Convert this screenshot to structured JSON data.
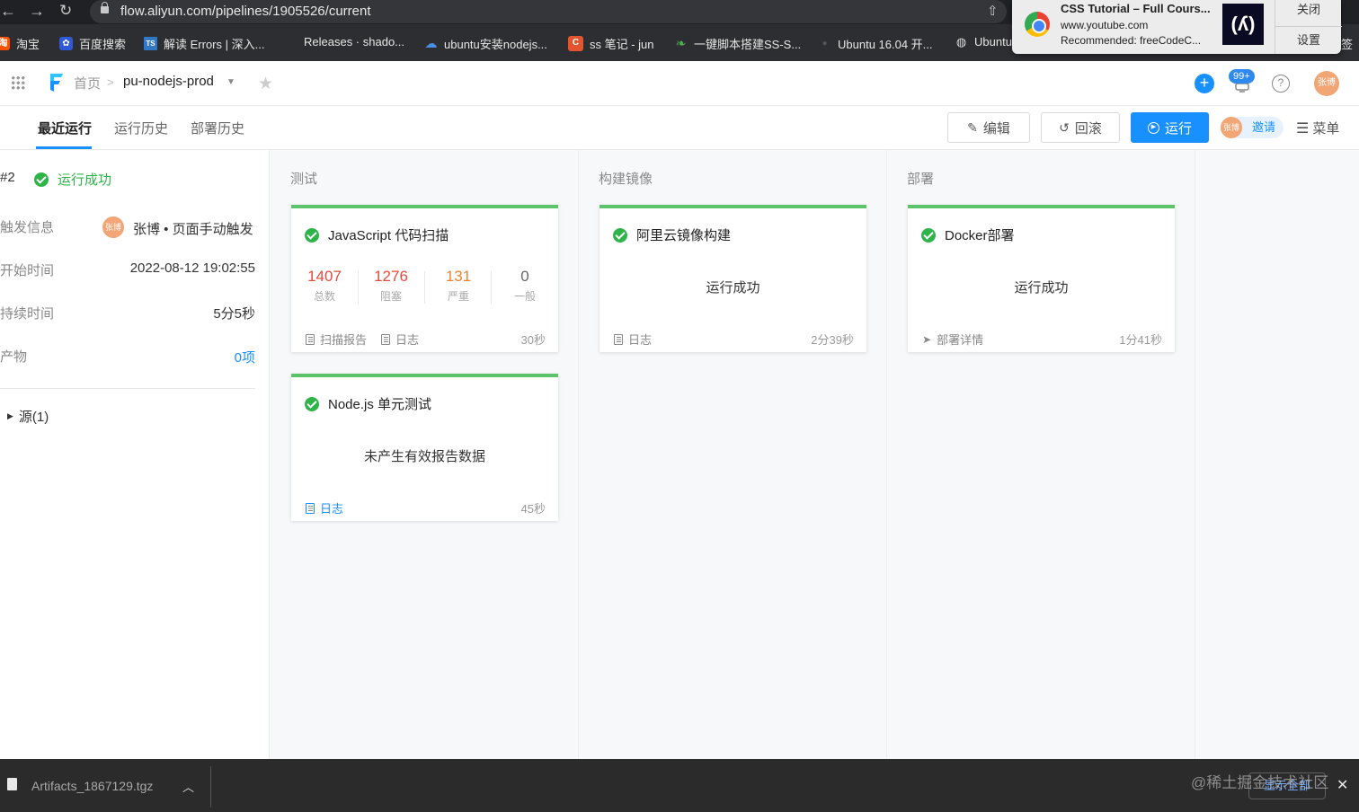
{
  "browser": {
    "url": "flow.aliyun.com/pipelines/1905526/current",
    "bookmarks": [
      {
        "label": "淘宝",
        "icon": "taobao-icon",
        "color": "#ff5000"
      },
      {
        "label": "百度搜索",
        "icon": "baidu-icon",
        "color": "#2f59d8"
      },
      {
        "label": "解读 Errors | 深入...",
        "icon": "ts-icon",
        "color": "#3178c6"
      },
      {
        "label": "Releases · shado...",
        "icon": "github-icon",
        "color": "#2d2e31"
      },
      {
        "label": "ubuntu安装nodejs...",
        "icon": "cloud-icon",
        "color": "#4a8fe7"
      },
      {
        "label": "ss 笔记 - jun",
        "icon": "c-icon",
        "color": "#e4552f"
      },
      {
        "label": "一键脚本搭建SS-S...",
        "icon": "leaf-icon",
        "color": "#4caf50"
      },
      {
        "label": "Ubuntu 16.04 开...",
        "icon": "github-icon",
        "color": "#2d2e31"
      },
      {
        "label": "Ubuntu",
        "icon": "ubuntu-icon",
        "color": "#2d2e31"
      }
    ],
    "trailing_bookmark": "签"
  },
  "notification": {
    "title": "CSS Tutorial – Full Cours...",
    "site": "www.youtube.com",
    "body": "Recommended: freeCodeC...",
    "thumb_text": "(ʎ)",
    "close_label": "关闭",
    "settings_label": "设置"
  },
  "header": {
    "breadcrumb_home": "首页",
    "breadcrumb_separator": ">",
    "pipeline_name": "pu-nodejs-prod",
    "notification_count": "99+",
    "avatar_text": "张博"
  },
  "tabs": [
    {
      "label": "最近运行",
      "active": true
    },
    {
      "label": "运行历史",
      "active": false
    },
    {
      "label": "部署历史",
      "active": false
    }
  ],
  "toolbar": {
    "edit_label": "编辑",
    "rollback_label": "回滚",
    "run_label": "运行",
    "invite_avatar": "张博",
    "invite_label": "邀请",
    "menu_label": "菜单"
  },
  "run_info": {
    "run_number": "#2",
    "status": "运行成功",
    "trigger_label": "触发信息",
    "trigger_avatar": "张博",
    "trigger_value": "张博 • 页面手动触发",
    "start_label": "开始时间",
    "start_value": "2022-08-12 19:02:55",
    "duration_label": "持续时间",
    "duration_value": "5分5秒",
    "artifacts_label": "产物",
    "artifacts_value": "0项",
    "source_label": "源(1)"
  },
  "stages": [
    {
      "name": "测试",
      "jobs": [
        {
          "title": "JavaScript 代码扫描",
          "stats": [
            {
              "value": "1407",
              "label": "总数",
              "color": "#e14b3b"
            },
            {
              "value": "1276",
              "label": "阻塞",
              "color": "#e14b3b"
            },
            {
              "value": "131",
              "label": "严重",
              "color": "#f0822f"
            },
            {
              "value": "0",
              "label": "一般",
              "color": "#666666"
            }
          ],
          "links": [
            "扫描报告",
            "日志"
          ],
          "duration": "30秒"
        },
        {
          "title": "Node.js 单元测试",
          "message": "未产生有效报告数据",
          "links": [
            "日志"
          ],
          "duration": "45秒"
        }
      ]
    },
    {
      "name": "构建镜像",
      "jobs": [
        {
          "title": "阿里云镜像构建",
          "message": "运行成功",
          "links": [
            "日志"
          ],
          "duration": "2分39秒"
        }
      ]
    },
    {
      "name": "部署",
      "jobs": [
        {
          "title": "Docker部署",
          "message": "运行成功",
          "links": [
            "部署详情"
          ],
          "duration": "1分41秒"
        }
      ]
    }
  ],
  "download_bar": {
    "filename": "Artifacts_1867129.tgz",
    "show_all_label": "显示全部",
    "watermark": "@稀土掘金技术社区"
  },
  "colors": {
    "accent": "#1890ff",
    "success": "#2fb44a",
    "card_top": "#5bc46a"
  }
}
